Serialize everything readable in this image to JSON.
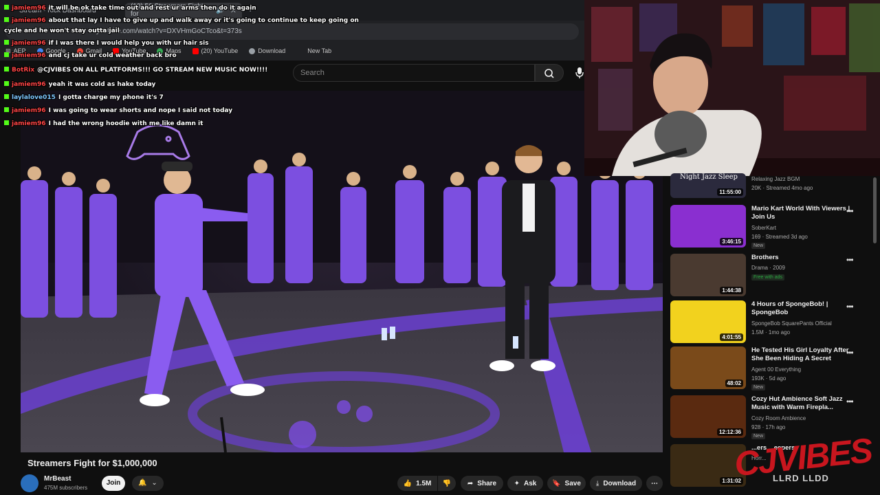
{
  "browser": {
    "tabs": [
      {
        "label": "Stream - Kick Dashboard",
        "active": false
      },
      {
        "label": "(10) 50 Streamers Fight for",
        "active": true
      }
    ],
    "url": "youtube.com/watch?v=DXVHmGoCTco&t=373s",
    "bookmarks": [
      {
        "label": "AEP",
        "icon": "grid-icon"
      },
      {
        "label": "Google",
        "icon": "google-icon"
      },
      {
        "label": "Gmail",
        "icon": "gmail-icon"
      },
      {
        "label": "YouTube",
        "icon": "youtube-icon"
      },
      {
        "label": "Maps",
        "icon": "maps-icon"
      },
      {
        "label": "(20) YouTube",
        "icon": "youtube-icon"
      },
      {
        "label": "Download",
        "icon": "globe-icon"
      },
      {
        "label": "New Tab",
        "icon": ""
      }
    ]
  },
  "youtube": {
    "search_placeholder": "Search"
  },
  "chat": [
    {
      "user": "jamiem96",
      "text": "it will be ok take time out and rest ur arms then do it again"
    },
    {
      "user": "jamiem96",
      "text": "about that lay I have to give up and walk away or it's going to continue to keep going on"
    },
    {
      "user": "",
      "text": "cycle and he won't stay outta jail"
    },
    {
      "user": "jamiem96",
      "text": "if I was there I would help you with ur hair sis"
    },
    {
      "user": "jamiem96",
      "text": "and cj take ur cold weather back bro"
    },
    {
      "user": "BotRix",
      "text": "@CJVIBES ON ALL PLATFORMS!!! GO STREAM NEW MUSIC NOW!!!!"
    },
    {
      "user": "jamiem96",
      "text": "yeah it was cold as hake today"
    },
    {
      "user": "laylalove015",
      "text": "I gotta charge my phone it's 7"
    },
    {
      "user": "jamiem96",
      "text": "I was going to wear shorts and nope I said not today"
    },
    {
      "user": "jamiem96",
      "text": "I had the wrong hoodie with me like damn it"
    }
  ],
  "video": {
    "title": "Streamers Fight for $1,000,000",
    "channel": "MrBeast",
    "subscribers": "475M subscribers",
    "join_label": "Join",
    "likes": "1.5M",
    "share_label": "Share",
    "ask_label": "Ask",
    "save_label": "Save",
    "download_label": "Download"
  },
  "recommendations": [
    {
      "title": "Night Jazz Sleep",
      "channel": "Relaxing Jazz BGM",
      "meta": "20K · Streamed 4mo ago",
      "duration": "11:55:00",
      "badge": "",
      "thumb": "#2b2a3d"
    },
    {
      "title": "Mario Kart World With Viewers | Join Us",
      "channel": "SoberKart",
      "meta": "169 · Streamed 3d ago",
      "duration": "3:46:15",
      "badge": "New",
      "thumb": "#8a2fd0"
    },
    {
      "title": "Brothers",
      "channel": "Drama · 2009",
      "meta": "",
      "duration": "1:44:38",
      "badge": "Free with ads",
      "thumb": "#4a3a30"
    },
    {
      "title": "4 Hours of SpongeBob! | SpongeBob",
      "channel": "SpongeBob SquarePants Official",
      "meta": "1.5M · 1mo ago",
      "duration": "4:01:55",
      "badge": "",
      "thumb": "#f2d21e"
    },
    {
      "title": "He Tested His Girl Loyalty After She Been Hiding A Secret",
      "channel": "Agent 00 Everything",
      "meta": "193K · 5d ago",
      "duration": "48:02",
      "badge": "New",
      "thumb": "#7a4a1a"
    },
    {
      "title": "Cozy Hut Ambience Soft Jazz Music with Warm Firepla...",
      "channel": "Cozy Room Ambience",
      "meta": "928 · 17h ago",
      "duration": "12:12:36",
      "badge": "New",
      "thumb": "#5a2a10"
    },
    {
      "title": "...ers ...eepers",
      "channel": "Horr...",
      "meta": "",
      "duration": "1:31:02",
      "badge": "",
      "thumb": "#3a2a14"
    }
  ],
  "overlay": {
    "watermark": "CJVIBES",
    "watermark_sub": "LLRD LLDD"
  },
  "colors": {
    "accent": "#ff0000",
    "kick_green": "#53fc18",
    "watermark_red": "#c8161e",
    "suit_purple": "#7a4bd6"
  }
}
